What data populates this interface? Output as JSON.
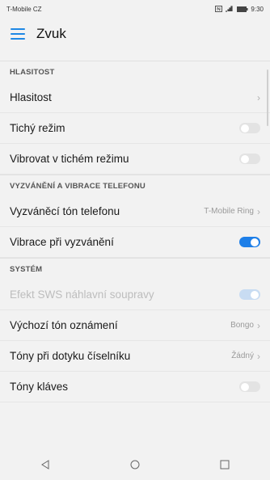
{
  "status_bar": {
    "carrier": "T-Mobile CZ",
    "time": "9:30"
  },
  "app_bar": {
    "title": "Zvuk"
  },
  "sections": {
    "volume": "HLASITOST",
    "ringing": "VYZVÁNĚNÍ A VIBRACE TELEFONU",
    "system": "SYSTÉM"
  },
  "rows": {
    "volume": {
      "label": "Hlasitost"
    },
    "silent": {
      "label": "Tichý režim",
      "enabled": false
    },
    "vibrate_silent": {
      "label": "Vibrovat v tichém režimu",
      "enabled": false
    },
    "ringtone": {
      "label": "Vyzváněcí tón telefonu",
      "value": "T-Mobile Ring"
    },
    "vibrate_ringing": {
      "label": "Vibrace při vyzvánění",
      "enabled": true
    },
    "sws": {
      "label": "Efekt SWS náhlavní soupravy",
      "enabled": true,
      "disabled": true
    },
    "notification": {
      "label": "Výchozí tón oznámení",
      "value": "Bongo"
    },
    "dialpad": {
      "label": "Tóny při dotyku číselníku",
      "value": "Žádný"
    },
    "keys": {
      "label": "Tóny kláves",
      "enabled": false
    }
  },
  "colors": {
    "accent": "#1e7fe8"
  }
}
